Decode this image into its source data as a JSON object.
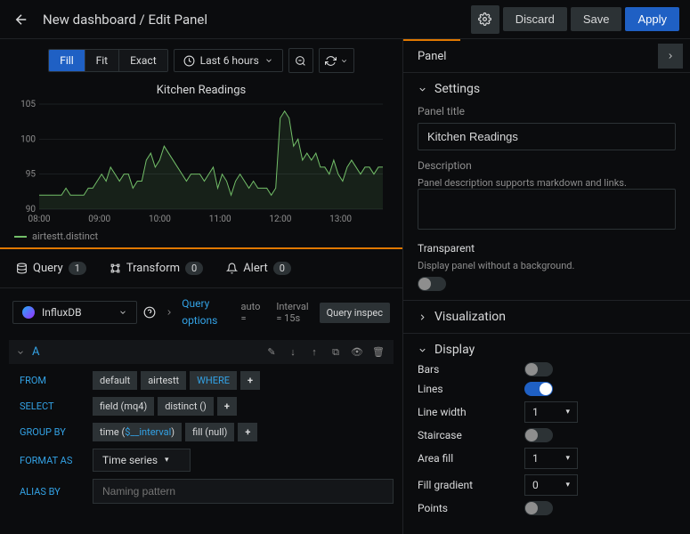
{
  "header": {
    "breadcrumb": "New dashboard / Edit Panel",
    "discard": "Discard",
    "save": "Save",
    "apply": "Apply"
  },
  "toolbar": {
    "fill": "Fill",
    "fit": "Fit",
    "exact": "Exact",
    "time_range": "Last 6 hours"
  },
  "chart_data": {
    "type": "line",
    "title": "Kitchen Readings",
    "xlabel": "",
    "ylabel": "",
    "ylim": [
      90,
      105
    ],
    "x_ticks": [
      "08:00",
      "09:00",
      "10:00",
      "11:00",
      "12:00",
      "13:00"
    ],
    "series": [
      {
        "name": "airtestt.distinct",
        "values": [
          92,
          92,
          92,
          92,
          92,
          92,
          93,
          92,
          92,
          92,
          92,
          93,
          93,
          94,
          95,
          94,
          96,
          95,
          94,
          95,
          95,
          93,
          94,
          94,
          97,
          98,
          96,
          97,
          99,
          98,
          97,
          96,
          95,
          94,
          95,
          95,
          95,
          94,
          95,
          96,
          93,
          95,
          94,
          92,
          94,
          95,
          94,
          93,
          94,
          93,
          93,
          93,
          92,
          93,
          103,
          104,
          103,
          99,
          100,
          97,
          98,
          97,
          98,
          96,
          96,
          95,
          97,
          95,
          94,
          96,
          97,
          96,
          95,
          96,
          96,
          95,
          96,
          96
        ]
      }
    ],
    "legend": "airtestt.distinct"
  },
  "tabs": {
    "query_label": "Query",
    "query_count": "1",
    "transform_label": "Transform",
    "transform_count": "0",
    "alert_label": "Alert",
    "alert_count": "0"
  },
  "datasource": {
    "name": "InfluxDB"
  },
  "query_options": {
    "label": "Query options",
    "interval_label": "Interval",
    "auto": "auto",
    "min_interval": "= 15s"
  },
  "inspector": "Query inspec",
  "query": {
    "letter": "A",
    "from_label": "FROM",
    "from_default": "default",
    "from_table": "airtestt",
    "where": "WHERE",
    "select_label": "SELECT",
    "select_field": "field (mq4)",
    "select_agg": "distinct ()",
    "group_by_label": "GROUP BY",
    "group_time": "time ($__interval)",
    "group_fill": "fill (null)",
    "format_label": "FORMAT AS",
    "format_value": "Time series",
    "alias_label": "ALIAS BY",
    "alias_placeholder": "Naming pattern"
  },
  "right": {
    "panel_tab": "Panel",
    "settings": "Settings",
    "panel_title_label": "Panel title",
    "panel_title_value": "Kitchen Readings",
    "description_label": "Description",
    "description_help": "Panel description supports markdown and links.",
    "transparent_label": "Transparent",
    "transparent_help": "Display panel without a background.",
    "visualization": "Visualization",
    "display": "Display",
    "bars": "Bars",
    "lines": "Lines",
    "line_width": "Line width",
    "line_width_val": "1",
    "staircase": "Staircase",
    "area_fill": "Area fill",
    "area_fill_val": "1",
    "fill_gradient": "Fill gradient",
    "fill_gradient_val": "0",
    "points": "Points"
  }
}
